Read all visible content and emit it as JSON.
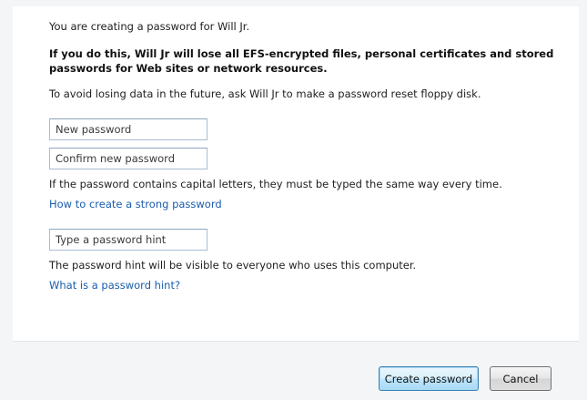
{
  "intro": "You are creating a password for Will Jr.",
  "warning": "If you do this, Will Jr will lose all EFS-encrypted files, personal certificates and stored passwords for Web sites or network resources.",
  "advice": "To avoid losing data in the future, ask Will Jr to make a password reset floppy disk.",
  "fields": {
    "new_password": {
      "placeholder": "New password",
      "value": ""
    },
    "confirm_password": {
      "placeholder": "Confirm new password",
      "value": ""
    },
    "hint": {
      "placeholder": "Type a password hint",
      "value": ""
    }
  },
  "capital_note": "If the password contains capital letters, they must be typed the same way every time.",
  "strong_password_link": "How to create a strong password",
  "hint_note": "The password hint will be visible to everyone who uses this computer.",
  "hint_link": "What is a password hint?",
  "buttons": {
    "create": "Create password",
    "cancel": "Cancel"
  },
  "colors": {
    "link": "#1a5cab",
    "footer_bg": "#f4f5f6",
    "primary_button_border": "#3c7fb1"
  }
}
